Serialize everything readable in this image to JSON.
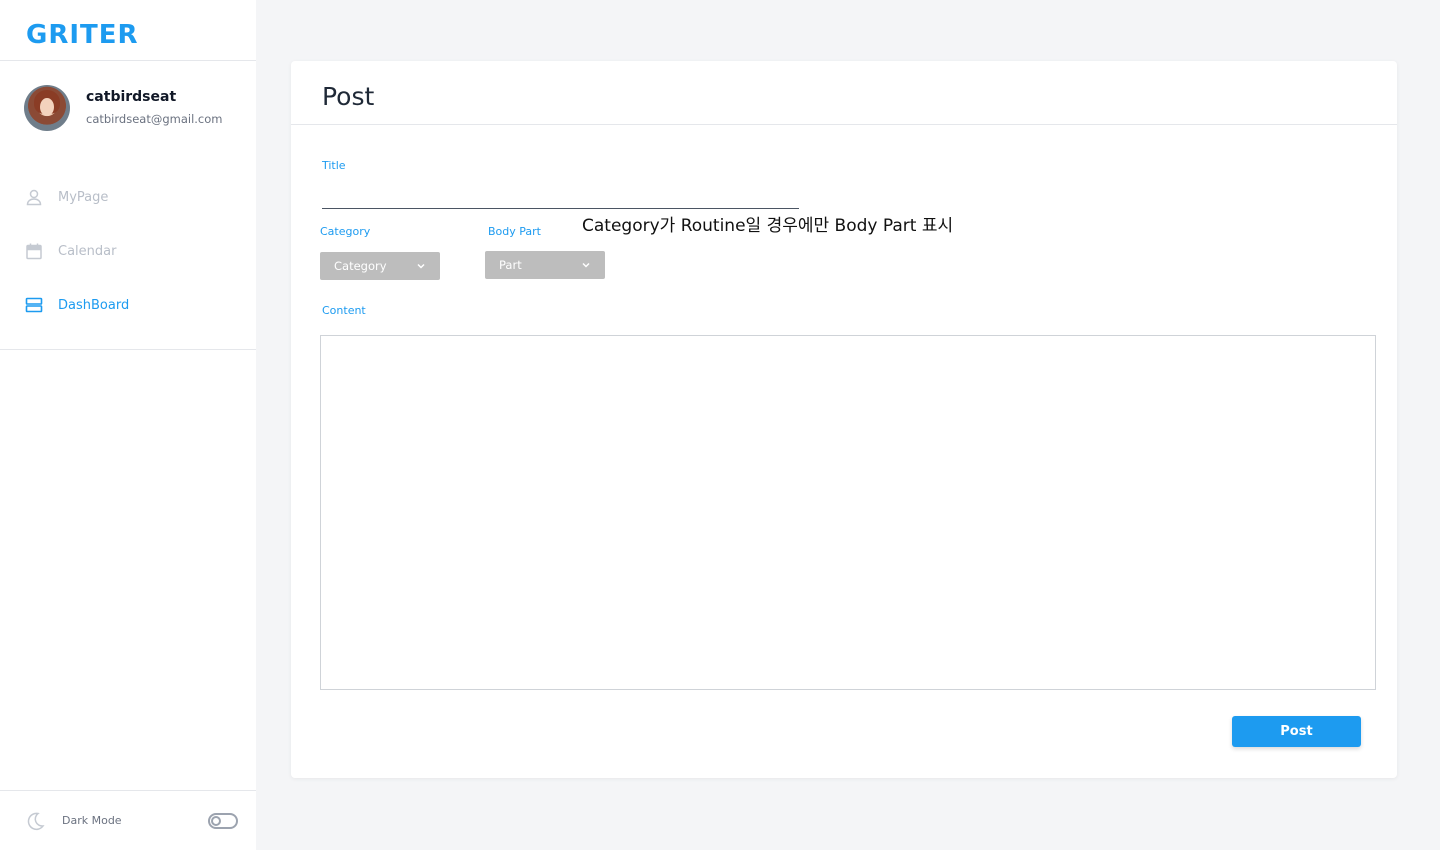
{
  "app": {
    "logo": "GRITER",
    "accent_color": "#1d9bf0"
  },
  "user": {
    "name": "catbirdseat",
    "email": "catbirdseat@gmail.com"
  },
  "nav": {
    "items": [
      {
        "label": "MyPage",
        "icon": "user-icon",
        "active": false
      },
      {
        "label": "Calendar",
        "icon": "calendar-icon",
        "active": false
      },
      {
        "label": "DashBoard",
        "icon": "dashboard-icon",
        "active": true
      }
    ]
  },
  "footer": {
    "dark_mode_label": "Dark Mode",
    "dark_mode_on": false
  },
  "post": {
    "heading": "Post",
    "title_label": "Title",
    "title_value": "",
    "category_label": "Category",
    "category_value": "Category",
    "body_part_label": "Body Part",
    "body_part_value": "Part",
    "note": "Category가 Routine일 경우에만 Body Part 표시",
    "content_label": "Content",
    "content_value": "",
    "submit_label": "Post"
  }
}
